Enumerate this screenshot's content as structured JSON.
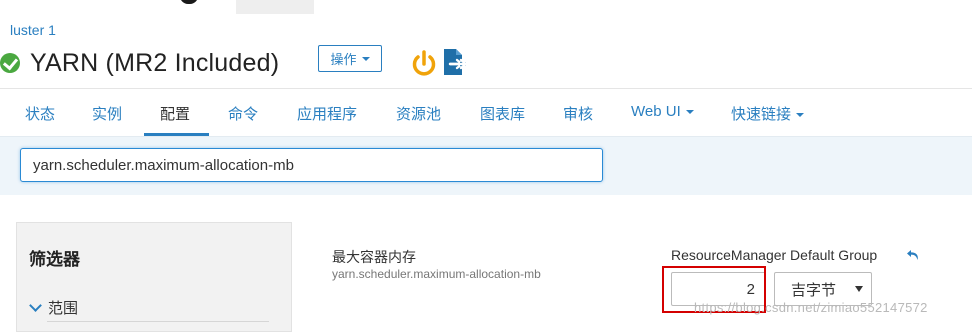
{
  "breadcrumb": "luster 1",
  "service": {
    "title": "YARN (MR2 Included)"
  },
  "actions": {
    "label": "操作"
  },
  "icons": {
    "status": "check-circle-icon",
    "power": "power-icon",
    "export": "export-icon",
    "undo": "undo-icon"
  },
  "nav": {
    "items": [
      {
        "label": "状态"
      },
      {
        "label": "实例"
      },
      {
        "label": "配置",
        "active": true
      },
      {
        "label": "命令"
      },
      {
        "label": "应用程序"
      },
      {
        "label": "资源池"
      },
      {
        "label": "图表库"
      },
      {
        "label": "审核"
      },
      {
        "label": "Web UI",
        "dropdown": true
      },
      {
        "label": "快速链接",
        "dropdown": true
      }
    ]
  },
  "search": {
    "value": "yarn.scheduler.maximum-allocation-mb"
  },
  "filters": {
    "title": "筛选器",
    "scope_label": "范围"
  },
  "property": {
    "display_name": "最大容器内存",
    "key": "yarn.scheduler.maximum-allocation-mb",
    "group_label": "ResourceManager Default Group",
    "value": "2",
    "unit": "吉字节"
  },
  "watermark": "https://blog.csdn.net/zimiao552147572",
  "colors": {
    "accent": "#2a7fc0",
    "status_ok": "#4aa840",
    "highlight_box": "#d40000",
    "warning_icon": "#f0a30a"
  }
}
